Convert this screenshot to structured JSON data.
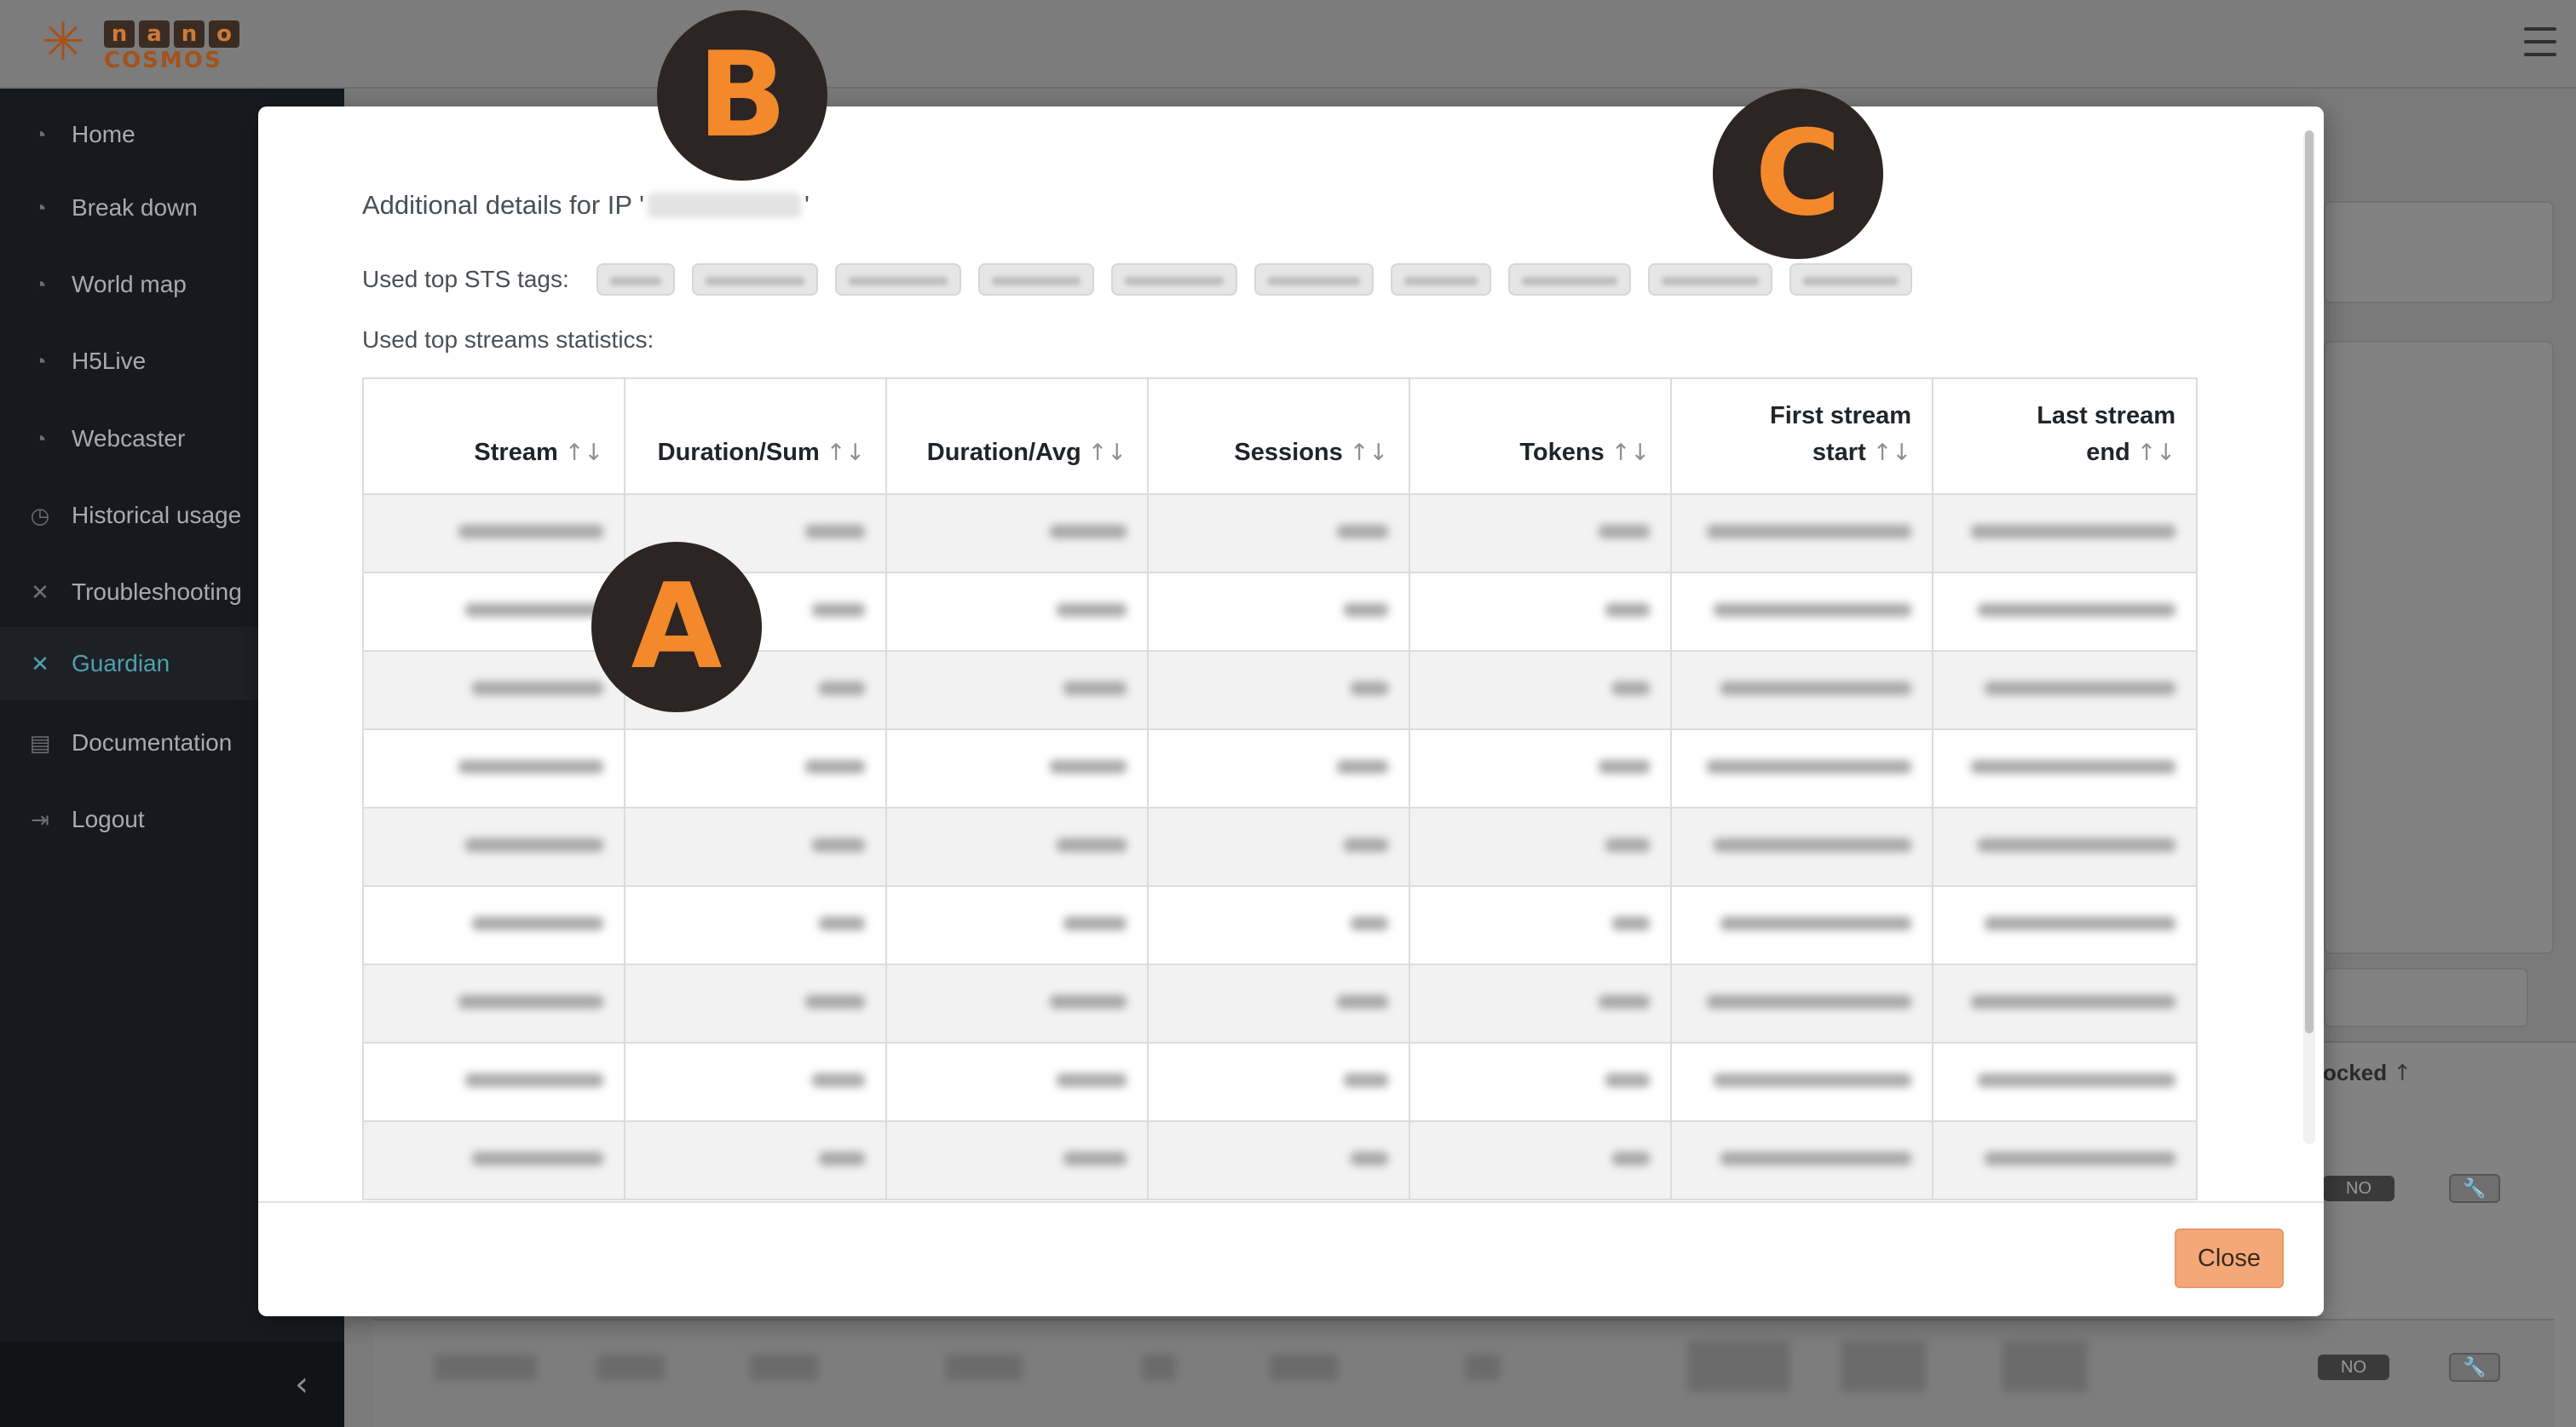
{
  "app": {
    "logo_letters": [
      "n",
      "a",
      "n",
      "o"
    ],
    "logo_word": "COSMOS"
  },
  "sidebar": {
    "items": [
      {
        "label": "Home",
        "icon": "gauge-icon"
      },
      {
        "label": "Break down",
        "icon": "gauge-icon"
      },
      {
        "label": "World map",
        "icon": "gauge-icon"
      },
      {
        "label": "H5Live",
        "icon": "gauge-icon"
      },
      {
        "label": "Webcaster",
        "icon": "gauge-icon"
      },
      {
        "label": "Historical usage",
        "icon": "clock-icon"
      },
      {
        "label": "Troubleshooting",
        "icon": "tools-icon"
      },
      {
        "label": "Guardian",
        "icon": "guardian-icon",
        "active": true
      },
      {
        "label": "Documentation",
        "icon": "document-icon"
      },
      {
        "label": "Logout",
        "icon": "logout-icon"
      }
    ]
  },
  "background": {
    "column_header": "ocked",
    "badge_no": "NO"
  },
  "modal": {
    "title_prefix": "Additional details for IP '",
    "title_suffix": "'",
    "sts_label": "Used top STS tags:",
    "streams_label": "Used top streams statistics:",
    "close_label": "Close",
    "table": {
      "headers": [
        {
          "line1": "",
          "line2": "Stream"
        },
        {
          "line1": "",
          "line2": "Duration/Sum"
        },
        {
          "line1": "",
          "line2": "Duration/Avg"
        },
        {
          "line1": "",
          "line2": "Sessions"
        },
        {
          "line1": "",
          "line2": "Tokens"
        },
        {
          "line1": "First stream",
          "line2": "start"
        },
        {
          "line1": "Last stream",
          "line2": "end"
        }
      ],
      "sort_glyph": "↑↓"
    }
  },
  "markers": {
    "a": "A",
    "b": "B",
    "c": "C"
  },
  "colors": {
    "accent": "#f3892a",
    "active_nav": "#4f9fb0",
    "close_button": "#f4a878",
    "sidebar": "#161a1e"
  }
}
